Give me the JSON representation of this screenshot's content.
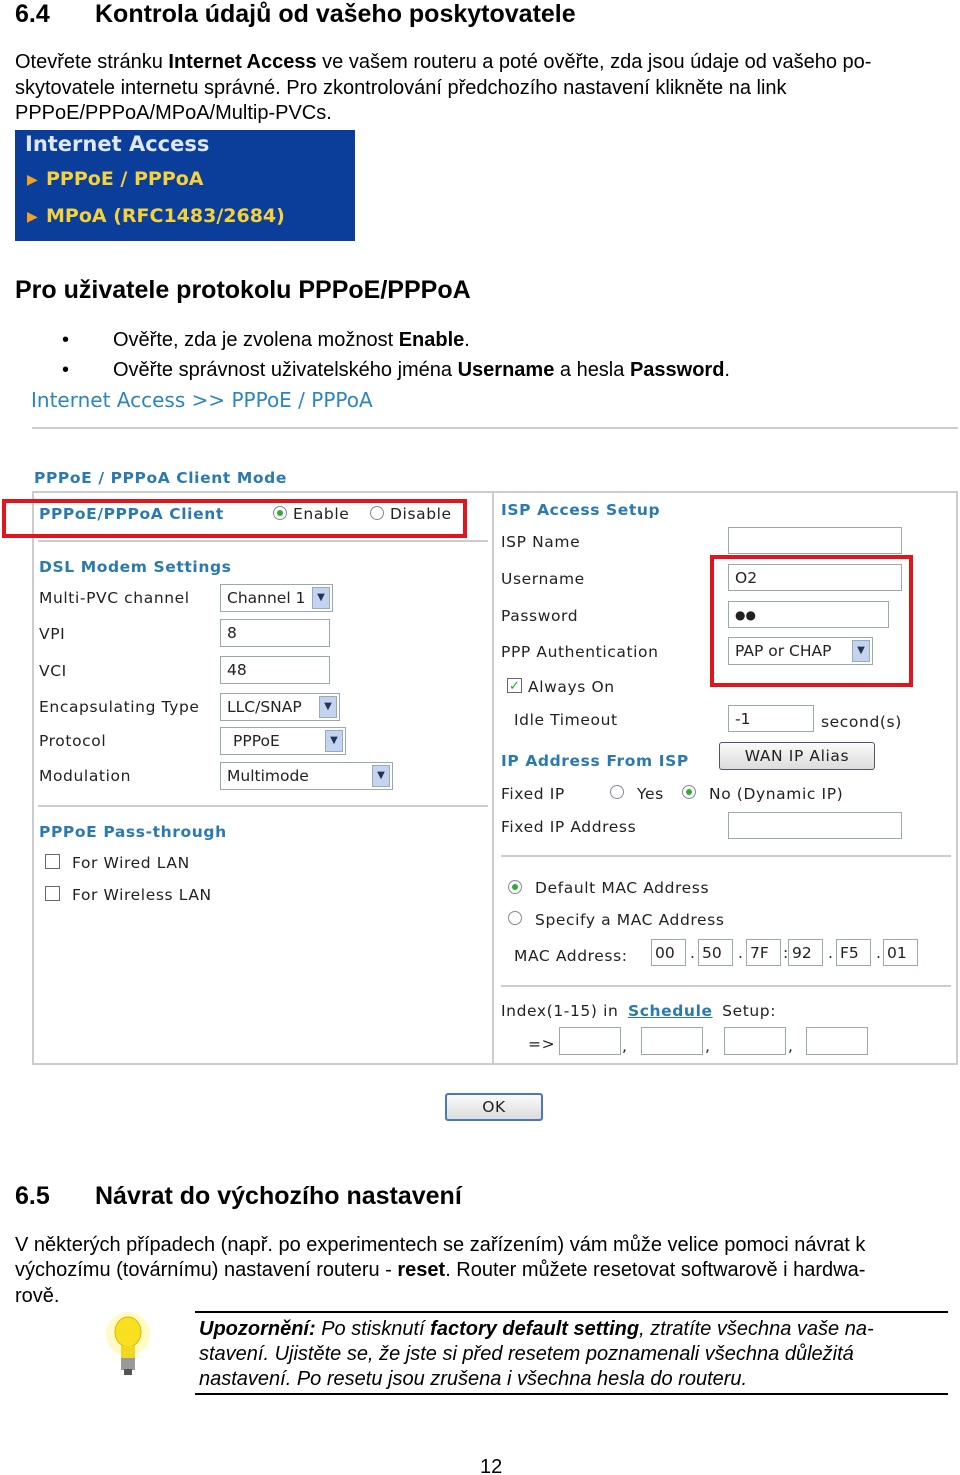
{
  "section64": {
    "number": "6.4",
    "title": "Kontrola údajů od vašeho poskytovatele"
  },
  "intro": {
    "l1a": "Otevřete stránku ",
    "l1b": "Internet Access",
    "l1c": " ve vašem routeru a poté ověřte, zda jsou údaje od vašeho po-",
    "l2": "skytovatele internetu správné. Pro zkontrolování předchozího nastavení klikněte na link",
    "l3": "PPPoE/PPPoA/MPoA/Multip-PVCs."
  },
  "nav": {
    "title": "Internet Access",
    "items": [
      "PPPoE / PPPoA",
      "MPoA (RFC1483/2684)"
    ],
    "bg": "#0a3e9a",
    "item_color": "#f5d23a"
  },
  "subheading": "Pro uživatele protokolu PPPoE/PPPoA",
  "bullets": [
    {
      "a": "Ověřte, zda je zvolena možnost ",
      "b": "Enable",
      "c": "."
    },
    {
      "a": "Ověřte správnost uživatelského jména ",
      "b": "Username",
      "c": " a hesla ",
      "d": "Password",
      "e": "."
    }
  ],
  "router": {
    "breadcrumb": "Internet Access >> PPPoE / PPPoA",
    "mode_title": "PPPoE / PPPoA Client Mode",
    "client": {
      "label": "PPPoE/PPPoA Client",
      "enable": "Enable",
      "disable": "Disable",
      "selected": "Enable"
    },
    "dsl": {
      "title": "DSL Modem Settings",
      "multi_pvc": "Multi-PVC channel",
      "multi_pvc_value": "Channel 1",
      "vpi": "VPI",
      "vpi_value": "8",
      "vci": "VCI",
      "vci_value": "48",
      "encap": "Encapsulating Type",
      "encap_value": "LLC/SNAP",
      "protocol": "Protocol",
      "protocol_value": "PPPoE",
      "modulation": "Modulation",
      "modulation_value": "Multimode"
    },
    "passthrough": {
      "title": "PPPoE Pass-through",
      "wired": "For Wired LAN",
      "wireless": "For Wireless LAN",
      "wired_checked": false,
      "wireless_checked": false
    },
    "isp": {
      "title": "ISP Access Setup",
      "isp_name": "ISP Name",
      "isp_name_value": "",
      "username": "Username",
      "username_value": "O2",
      "password": "Password",
      "password_value": "●●",
      "auth": "PPP Authentication",
      "auth_value": "PAP or CHAP",
      "always_on": "Always On",
      "always_on_checked": true,
      "idle": "Idle Timeout",
      "idle_value": "-1",
      "idle_unit": "second(s)"
    },
    "ip": {
      "title": "IP Address From ISP",
      "wan_alias": "WAN IP Alias",
      "fixed_ip": "Fixed IP",
      "yes": "Yes",
      "no": "No (Dynamic IP)",
      "selected": "No (Dynamic IP)",
      "fixed_addr": "Fixed IP Address",
      "fixed_addr_value": ""
    },
    "mac": {
      "default": "Default MAC Address",
      "specify": "Specify a MAC Address",
      "selected": "Default MAC Address",
      "label": "MAC Address:",
      "octets": [
        "00",
        "50",
        "7F",
        "92",
        "F5",
        "01"
      ],
      "seps": [
        ".",
        ".",
        ":",
        ".",
        "."
      ]
    },
    "schedule": {
      "a": "Index(1-15) in",
      "link": "Schedule",
      "b": "Setup:",
      "arrow": "=>",
      "sep": ","
    },
    "ok": "OK"
  },
  "section65": {
    "number": "6.5",
    "title": "Návrat do výchozího nastavení"
  },
  "reset": {
    "l1": "V některých případech (např. po experimentech se zařízením) vám může velice pomoci návrat k",
    "l2a": "výchozímu (továrnímu) nastavení routeru - ",
    "l2b": "reset",
    "l2c": ". Router můžete resetovat softwarově i hardwa-",
    "l3": "rově."
  },
  "note": {
    "a": "Upozornění:",
    "b": " Po stisknutí ",
    "c": "factory default setting",
    "d": ", ztratíte všechna vaše na-",
    "l2": "stavení. Ujistěte se, že jste si před resetem poznamenali všechna důležitá",
    "l3": "nastavení. Po resetu jsou zrušena i všechna hesla do routeru."
  },
  "page_number": "12"
}
